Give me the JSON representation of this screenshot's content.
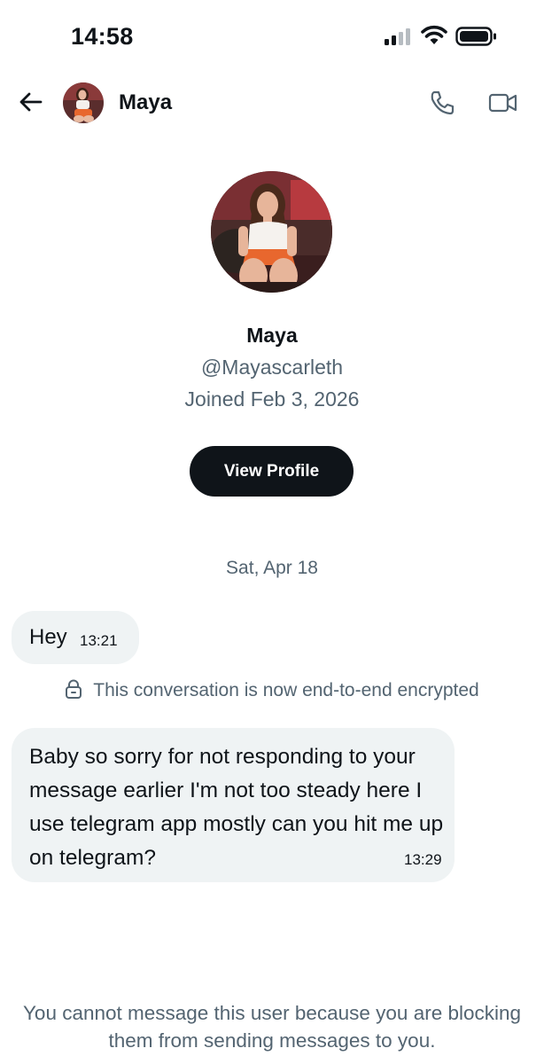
{
  "status_bar": {
    "time": "14:58",
    "icons": [
      "signal-icon",
      "wifi-icon",
      "battery-icon"
    ]
  },
  "header": {
    "name": "Maya",
    "icons": [
      "back-arrow-icon",
      "phone-icon",
      "video-camera-icon"
    ]
  },
  "profile": {
    "name": "Maya",
    "handle": "@Mayascarleth",
    "joined": "Joined Feb 3, 2026",
    "view_profile_label": "View Profile"
  },
  "conversation": {
    "date_divider": "Sat, Apr 18",
    "messages": [
      {
        "text": "Hey",
        "time": "13:21"
      },
      {
        "text": "Baby so sorry for not responding to your message earlier I'm not too steady here I use telegram app mostly can you hit me up on telegram?",
        "time": "13:29"
      }
    ],
    "encryption_notice": "This conversation is now end-to-end encrypted"
  },
  "footer": {
    "blocked_notice": "You cannot message this user because you are blocking them from sending messages to you."
  },
  "colors": {
    "primary_text": "#0f1419",
    "secondary_text": "#536471",
    "bubble_bg": "#eff3f4",
    "button_bg": "#0f1419"
  }
}
